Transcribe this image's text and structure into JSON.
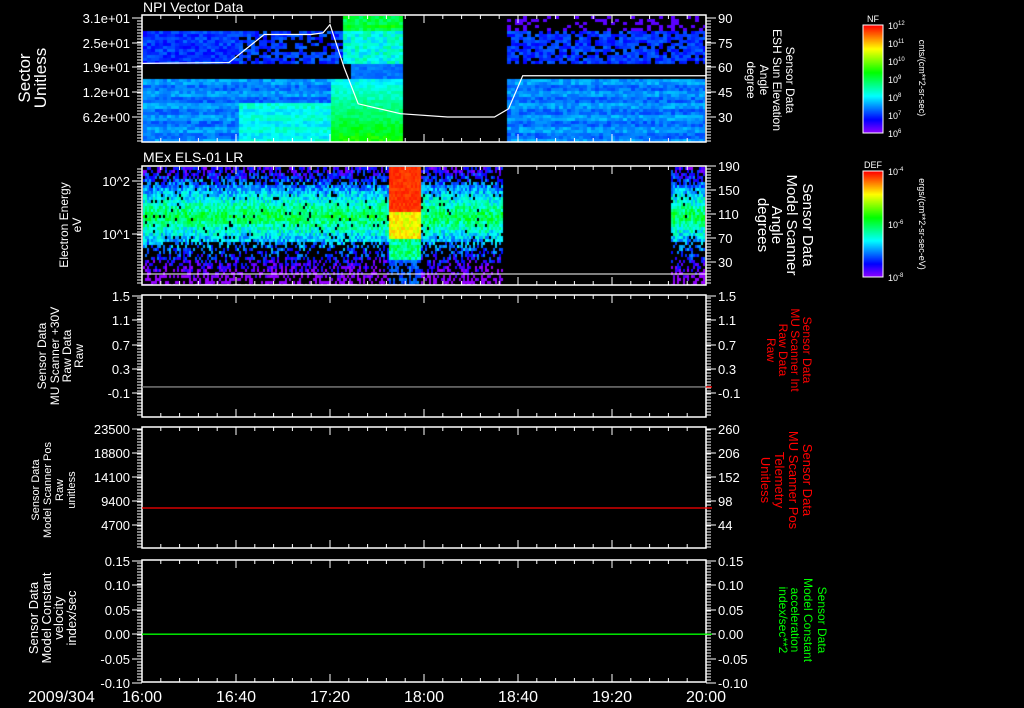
{
  "chart_data": [
    {
      "type": "heatmap",
      "title": "NPI Vector Data",
      "ylabel": [
        "Sector",
        "Unitless"
      ],
      "yticks": [
        "3.1e+01",
        "2.5e+01",
        "1.9e+01",
        "1.2e+01",
        "6.2e+00"
      ],
      "y2label": [
        "Sensor Data",
        "ESH Sun Elevation",
        "Angle",
        "degree"
      ],
      "y2ticks": [
        "90",
        "75",
        "60",
        "45",
        "30"
      ],
      "y2lim": [
        15,
        90
      ],
      "data_gap_minutes": [
        111,
        154.5
      ],
      "overlay_line": {
        "name": "ESH Sun Elevation",
        "color": "#ffffff",
        "x_minutes": [
          0,
          37,
          52,
          72,
          77,
          80,
          86,
          92,
          110,
          130,
          150,
          156,
          162,
          240
        ],
        "y": [
          62.5,
          63,
          80,
          80,
          81,
          86,
          60,
          38,
          32,
          30,
          30,
          35,
          55,
          55
        ]
      },
      "colorbar": {
        "label": "NF",
        "ticks": [
          "10^12",
          "10^11",
          "10^10",
          "10^9",
          "10^8",
          "10^7",
          "10^6"
        ],
        "units": "cnts/(cm**2-sr-sec)"
      }
    },
    {
      "type": "heatmap",
      "title": "MEx ELS-01 LR",
      "ylabel": [
        "Electron Energy",
        "eV"
      ],
      "yticks": [
        "10^2",
        "10^1"
      ],
      "y2label": [
        "Sensor Data",
        "Model Scanner",
        "Angle",
        "degrees"
      ],
      "y2ticks": [
        "190",
        "150",
        "110",
        "70",
        "30"
      ],
      "y2lim": [
        0,
        190
      ],
      "data_gap_minutes": [
        153.6,
        224.7
      ],
      "burst_minutes": [
        104.7,
        118
      ],
      "overlay_line": {
        "name": "Model Scanner Angle",
        "color": "#ffffff",
        "value": 10
      },
      "colorbar": {
        "label": "DEF",
        "ticks": [
          "10^-4",
          "10^-6",
          "10^-8"
        ],
        "units": "ergs/(cm**2-sr-sec-eV)"
      }
    },
    {
      "type": "line",
      "ylabel": [
        "Sensor Data",
        "MU Scanner +30V",
        "Raw Data",
        "Raw"
      ],
      "yticks": [
        "1.5",
        "1.1",
        "0.7",
        "0.3",
        "-0.1"
      ],
      "ylim": [
        -0.18,
        1.5
      ],
      "y2label": [
        "Sensor Data",
        "MU Scanner Int",
        "Raw Data",
        "Raw"
      ],
      "y2ticks": [
        "1.5",
        "1.1",
        "0.7",
        "0.3",
        "-0.1"
      ],
      "series": [
        {
          "name": "MU Scanner +30V",
          "color": "#808080",
          "value": 0.0
        }
      ],
      "y2color": "#ff0000"
    },
    {
      "type": "line",
      "ylabel": [
        "Sensor Data",
        "Model Scanner Pos",
        "Raw",
        "unitless"
      ],
      "yticks": [
        "23500",
        "18800",
        "14100",
        "9400",
        "4700"
      ],
      "ylim": [
        0,
        23700
      ],
      "y2label": [
        "Sensor Data",
        "MU Scanner Pos",
        "Telemetry",
        "Unitless"
      ],
      "y2ticks": [
        "260",
        "206",
        "152",
        "98",
        "44"
      ],
      "series": [
        {
          "name": "Model Scanner Pos",
          "color": "#ff0000",
          "value": 8030
        }
      ],
      "y2color": "#ff0000"
    },
    {
      "type": "line",
      "ylabel": [
        "Sensor Data",
        "Model Constant",
        "velocity",
        "index/sec"
      ],
      "yticks": [
        "0.15",
        "0.10",
        "0.05",
        "0.00",
        "-0.05",
        "-0.10"
      ],
      "ylim": [
        -0.1,
        0.15
      ],
      "y2label": [
        "Sensor Data",
        "Model Constant",
        "acceleration",
        "index/sec**2"
      ],
      "y2ticks": [
        "0.15",
        "0.10",
        "0.05",
        "0.00",
        "-0.05",
        "-0.10"
      ],
      "series": [
        {
          "name": "Model Constant velocity",
          "color": "#00ff00",
          "value": 0.0
        }
      ],
      "y2color": "#00ff00"
    }
  ],
  "xaxis": {
    "date": "2009/304",
    "ticks": [
      "16:00",
      "16:40",
      "17:20",
      "18:00",
      "18:40",
      "19:20",
      "20:00"
    ],
    "range_minutes": [
      0,
      240
    ]
  }
}
